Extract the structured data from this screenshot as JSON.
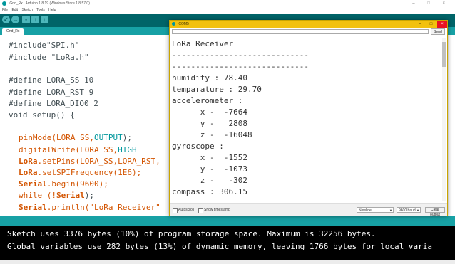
{
  "ide": {
    "title": "Gnd_Rx | Arduino 1.8.19 (Windows Store 1.8.57.0)",
    "window_controls": "– □ ×",
    "menu": [
      "File",
      "Edit",
      "Sketch",
      "Tools",
      "Help"
    ],
    "toolbar": {
      "verify": "✓",
      "upload": "→",
      "new": "▪",
      "open": "↑",
      "save": "↓"
    },
    "tab_label": "Gnd_Rx",
    "code": [
      "#include\"SPI.h\"",
      "#include \"LoRa.h\"",
      "#define LORA_SS 10",
      "#define LORA_RST 9",
      "#define LORA_DIO0 2",
      "void setup() {",
      "pinMode(LORA_SS,",
      "OUTPUT",
      ");",
      "digitalWrite(LORA_SS,",
      "HIGH",
      "LoRa",
      ".setPins(LORA_SS,LORA_RST,",
      ".setSPIFrequency(1E6);",
      "Serial",
      ".begin(9600);",
      "while (!",
      ");",
      ".println(\"LoRa Receiver\""
    ],
    "console": [
      "Sketch uses 3376 bytes (10%) of program storage space. Maximum is 32256 bytes.",
      "Global variables use 282 bytes (13%) of dynamic memory, leaving 1766 bytes for local varia"
    ]
  },
  "serial": {
    "title": "COM5",
    "minimize": "–",
    "maximize": "□",
    "close": "×",
    "input_placeholder": "",
    "send_label": "Send",
    "output": [
      "LoRa Receiver",
      "-----------------------------",
      "-----------------------------",
      "humidity : 78.40",
      "temparature : 29.70",
      "accelerometer :",
      "      x -  -7664",
      "      y -   2808",
      "      z -  -16048",
      "gyroscope :",
      "      x -  -1552",
      "      y -  -1073",
      "      z -   -302",
      "compass : 306.15",
      "--------------------------------"
    ],
    "autoscroll_label": "Autoscroll",
    "timestamp_label": "Show timestamp",
    "line_ending": "Newline",
    "baud": "9600 baud",
    "clear_label": "Clear output"
  },
  "colors": {
    "toolbar": "#006468",
    "tabbar": "#17a1a5",
    "serial_title": "#f2c10e",
    "close": "#e81123",
    "keyword_orange": "#d35400",
    "keyword_teal": "#00979c"
  },
  "icons": [
    "verify-icon",
    "upload-icon",
    "new-icon",
    "open-icon",
    "save-icon",
    "arduino-logo-icon",
    "close-icon",
    "minimize-icon",
    "maximize-icon"
  ]
}
